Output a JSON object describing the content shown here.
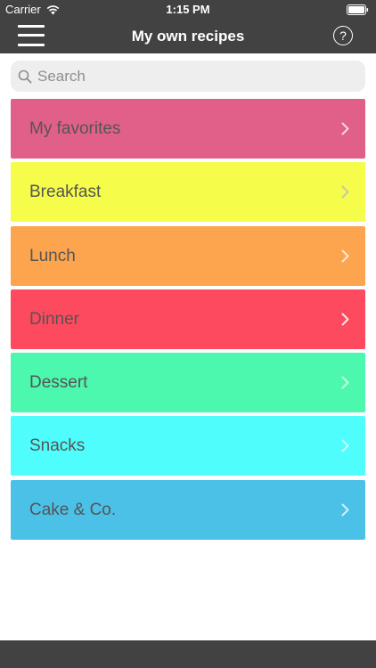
{
  "status_bar": {
    "carrier": "Carrier",
    "time": "1:15 PM"
  },
  "nav": {
    "title": "My own recipes",
    "help_label": "?",
    "background": "#424242"
  },
  "search": {
    "placeholder": "Search",
    "value": ""
  },
  "categories": [
    {
      "label": "My favorites",
      "color": "#e0608a"
    },
    {
      "label": "Breakfast",
      "color": "#f5fc4a"
    },
    {
      "label": "Lunch",
      "color": "#fca54e"
    },
    {
      "label": "Dinner",
      "color": "#fd4a5e"
    },
    {
      "label": "Dessert",
      "color": "#4cf8ae"
    },
    {
      "label": "Snacks",
      "color": "#4ffdfd"
    },
    {
      "label": "Cake & Co.",
      "color": "#4bc1e7"
    }
  ]
}
